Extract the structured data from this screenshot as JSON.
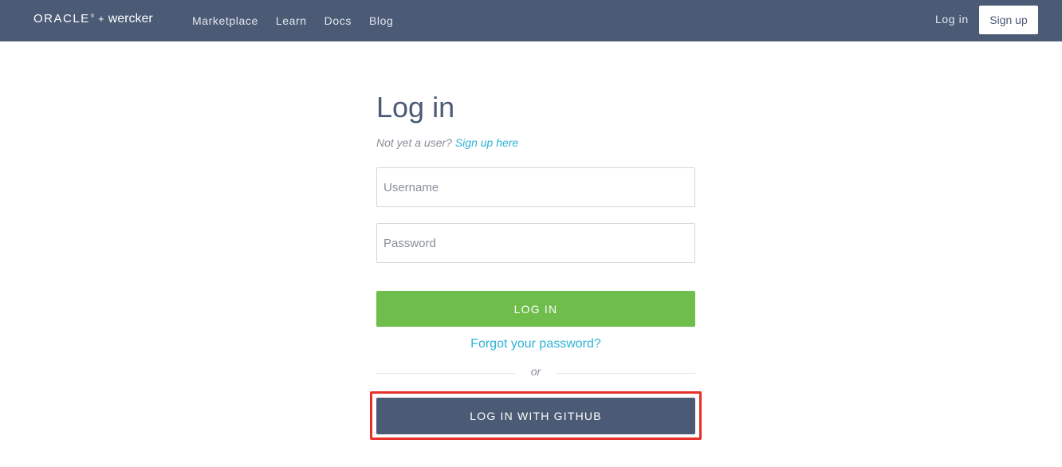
{
  "header": {
    "logo": {
      "brand": "ORACLE",
      "trademark": "®",
      "plus": "+",
      "product": "wercker"
    },
    "nav": [
      "Marketplace",
      "Learn",
      "Docs",
      "Blog"
    ],
    "login_label": "Log in",
    "signup_label": "Sign up"
  },
  "login_form": {
    "title": "Log in",
    "prompt": "Not yet a user?",
    "signup_link": "Sign up here",
    "username_placeholder": "Username",
    "password_placeholder": "Password",
    "submit_label": "LOG IN",
    "forgot_label": "Forgot your password?",
    "divider_text": "or",
    "github_label": "LOG IN WITH GITHUB"
  },
  "colors": {
    "header_bg": "#4b5a75",
    "primary_green": "#6fbd4b",
    "link_blue": "#2fb3d6",
    "highlight_red": "#e8302a"
  }
}
